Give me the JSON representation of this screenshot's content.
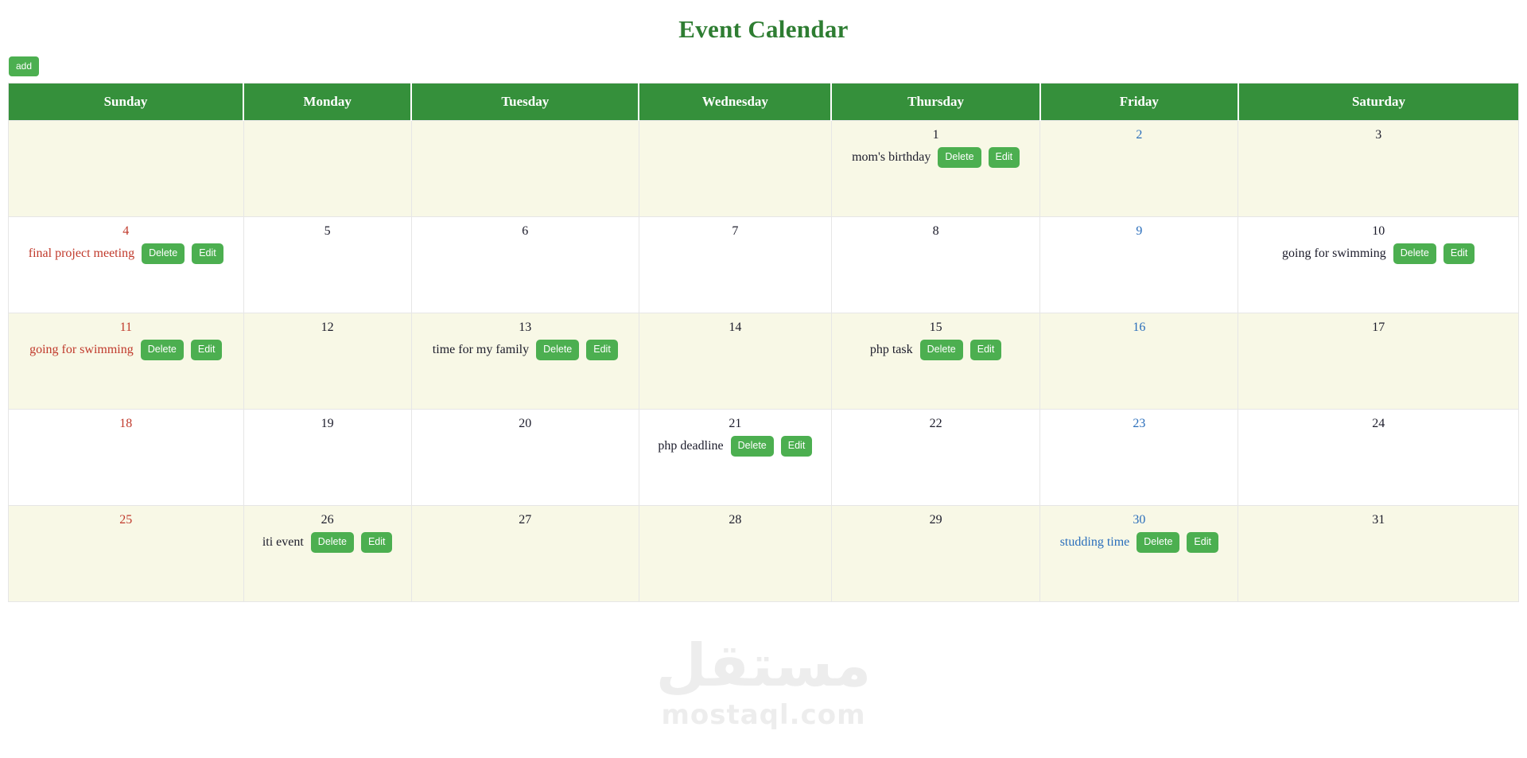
{
  "page": {
    "title": "Event Calendar",
    "title_color": "#2e7d32"
  },
  "toolbar": {
    "add_label": "add",
    "add_color": "#4caf50"
  },
  "calendar": {
    "header_bg": "#35903b",
    "alt_row_bg": "#f8f8e6",
    "sunday_color": "#c0392b",
    "friday_color": "#2a6ebb",
    "weekdays": [
      "Sunday",
      "Monday",
      "Tuesday",
      "Wednesday",
      "Thursday",
      "Friday",
      "Saturday"
    ],
    "delete_label": "Delete",
    "edit_label": "Edit",
    "weeks": [
      [
        {
          "day": ""
        },
        {
          "day": ""
        },
        {
          "day": ""
        },
        {
          "day": ""
        },
        {
          "day": "1",
          "event": "mom's birthday"
        },
        {
          "day": "2"
        },
        {
          "day": "3"
        }
      ],
      [
        {
          "day": "4",
          "event": "final project meeting"
        },
        {
          "day": "5"
        },
        {
          "day": "6"
        },
        {
          "day": "7"
        },
        {
          "day": "8"
        },
        {
          "day": "9"
        },
        {
          "day": "10",
          "event": "going for swimming"
        }
      ],
      [
        {
          "day": "11",
          "event": "going for swimming"
        },
        {
          "day": "12"
        },
        {
          "day": "13",
          "event": "time for my family"
        },
        {
          "day": "14"
        },
        {
          "day": "15",
          "event": "php task"
        },
        {
          "day": "16"
        },
        {
          "day": "17"
        }
      ],
      [
        {
          "day": "18"
        },
        {
          "day": "19"
        },
        {
          "day": "20"
        },
        {
          "day": "21",
          "event": "php deadline"
        },
        {
          "day": "22"
        },
        {
          "day": "23"
        },
        {
          "day": "24"
        }
      ],
      [
        {
          "day": "25"
        },
        {
          "day": "26",
          "event": "iti event"
        },
        {
          "day": "27"
        },
        {
          "day": "28"
        },
        {
          "day": "29"
        },
        {
          "day": "30",
          "event": "studding time"
        },
        {
          "day": "31"
        }
      ]
    ]
  },
  "watermark": {
    "arabic": "مستقل",
    "domain": "mostaql.com"
  }
}
